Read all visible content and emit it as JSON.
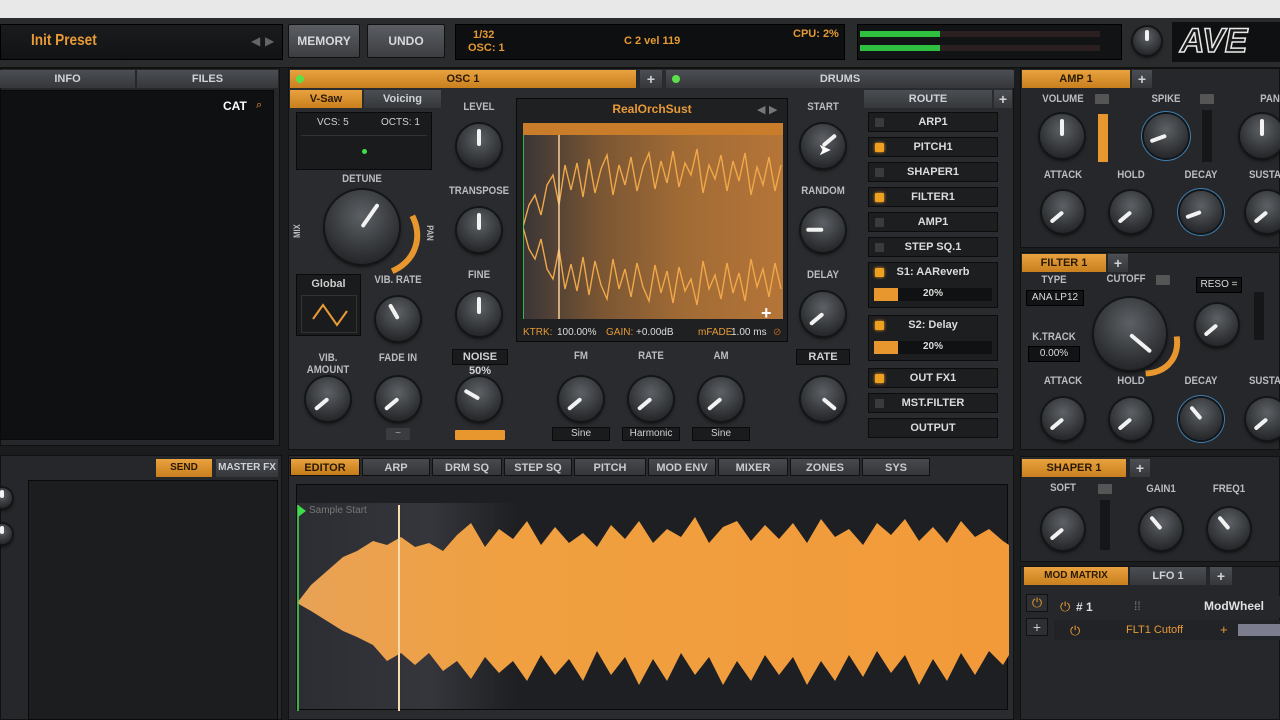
{
  "header": {
    "preset_name": "Init Preset",
    "memory_label": "MEMORY",
    "undo_label": "UNDO",
    "lcd_line1": "1/32",
    "lcd_line2": "OSC: 1",
    "note_info": "C 2 vel 119",
    "cpu": "CPU: 2%",
    "logo_text": "AVE"
  },
  "browser": {
    "tab_info": "INFO",
    "tab_files": "FILES",
    "cat_label": "CAT",
    "send_rack": "SEND RACK",
    "master_fx": "MASTER FX"
  },
  "osc": {
    "title": "OSC 1",
    "drums_title": "DRUMS",
    "vsaw_tab": "V-Saw",
    "voicing_tab": "Voicing",
    "vcs": "VCS: 5",
    "octs": "OCTS: 1",
    "detune": "DETUNE",
    "mix": "MIX",
    "pan": "PAN",
    "global": "Global",
    "vib_rate": "VIB. RATE",
    "vib_amount": "VIB. AMOUNT",
    "fade_in": "FADE IN",
    "level": "LEVEL",
    "transpose": "TRANSPOSE",
    "fine": "FINE",
    "noise": "NOISE 50%",
    "sample_name": "RealOrchSust",
    "ktrk_label": "KTRK:",
    "ktrk_value": "100.00%",
    "gain_label": "GAIN:",
    "gain_value": "+0.00dB",
    "mfade_label": "mFADE:",
    "mfade_value": "1.00 ms",
    "start": "START",
    "random": "RANDOM",
    "delay": "DELAY",
    "rate_right": "RATE",
    "fm": "FM",
    "rate": "RATE",
    "am": "AM",
    "fm_wave": "Sine",
    "rate_wave": "Harmonic",
    "am_wave": "Sine"
  },
  "route": {
    "title": "ROUTE",
    "items": [
      {
        "label": "ARP1",
        "led": false
      },
      {
        "label": "PITCH1",
        "led": true
      },
      {
        "label": "SHAPER1",
        "led": false
      },
      {
        "label": "FILTER1",
        "led": true
      },
      {
        "label": "AMP1",
        "led": false
      },
      {
        "label": "STEP SQ.1",
        "led": false
      }
    ],
    "send1_label": "S1: AAReverb",
    "send1_value": "20%",
    "send1_level": 0.2,
    "send2_label": "S2: Delay",
    "send2_value": "20%",
    "send2_level": 0.2,
    "out_fx": "OUT FX1",
    "mst_filter": "MST.FILTER",
    "output": "OUTPUT"
  },
  "tabs": [
    "EDITOR",
    "ARP",
    "DRM SQ",
    "STEP SQ",
    "PITCH",
    "MOD ENV",
    "MIXER",
    "ZONES",
    "SYS"
  ],
  "editor": {
    "sample_start": "Sample Start"
  },
  "amp": {
    "title": "AMP 1",
    "volume": "VOLUME",
    "spike": "SPIKE",
    "pan": "PAN",
    "attack": "ATTACK",
    "hold": "HOLD",
    "decay": "DECAY",
    "sustain": "SUSTA"
  },
  "filter": {
    "title": "FILTER 1",
    "type_label": "TYPE",
    "type_value": "ANA LP12",
    "cutoff": "CUTOFF",
    "reso": "RESO =",
    "ktrack_label": "K.TRACK",
    "ktrack_value": "0.00%",
    "attack": "ATTACK",
    "hold": "HOLD",
    "decay": "DECAY",
    "sustain": "SUSTA"
  },
  "shaper": {
    "title": "SHAPER 1",
    "soft": "SOFT",
    "gain": "GAIN1",
    "freq": "FREQ1"
  },
  "modmatrix": {
    "tab_matrix": "MOD MATRIX",
    "tab_lfo": "LFO 1",
    "slot": "# 1",
    "source": "ModWheel",
    "target": "FLT1 Cutoff"
  },
  "colors": {
    "accent": "#e89a38",
    "panel": "#26272a",
    "background": "#1b1c1e"
  }
}
